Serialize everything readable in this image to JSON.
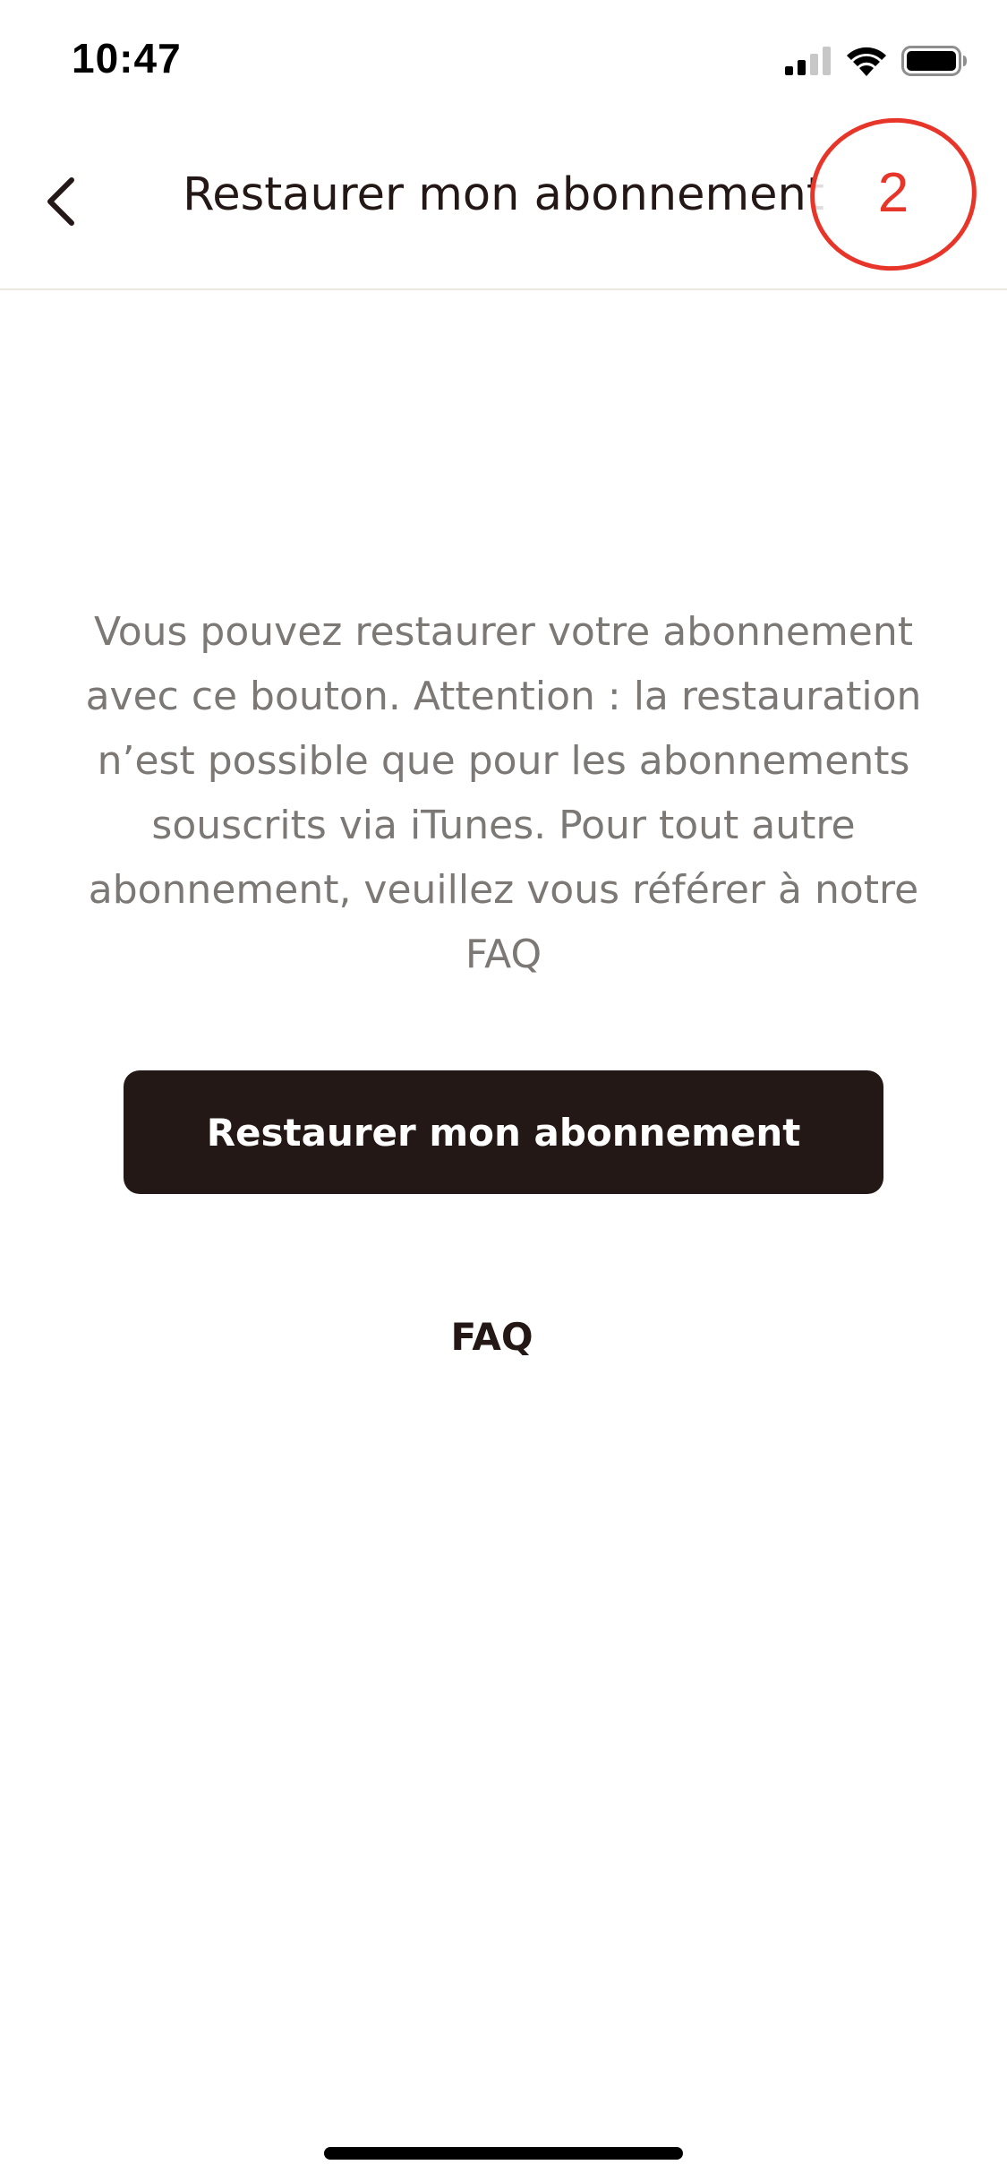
{
  "status_bar": {
    "time": "10:47",
    "icons": [
      "signal-icon",
      "wifi-icon",
      "battery-icon"
    ]
  },
  "nav": {
    "back_icon": "chevron-left-icon",
    "title": "Restaurer mon abonnement"
  },
  "annotation": {
    "number": "2",
    "color": "#e8352a"
  },
  "content": {
    "description": "Vous pouvez restaurer votre abonnement avec ce bouton. Attention : la restauration n’est possible que pour les abonnements souscrits via iTunes. Pour tout autre abonnement, veuillez vous référer à notre FAQ",
    "restore_button_label": "Restaurer mon abonnement",
    "faq_label": "FAQ"
  },
  "colors": {
    "primary": "#231815",
    "text_muted": "#7b7875",
    "background": "#ffffff",
    "annotation": "#e8352a"
  }
}
